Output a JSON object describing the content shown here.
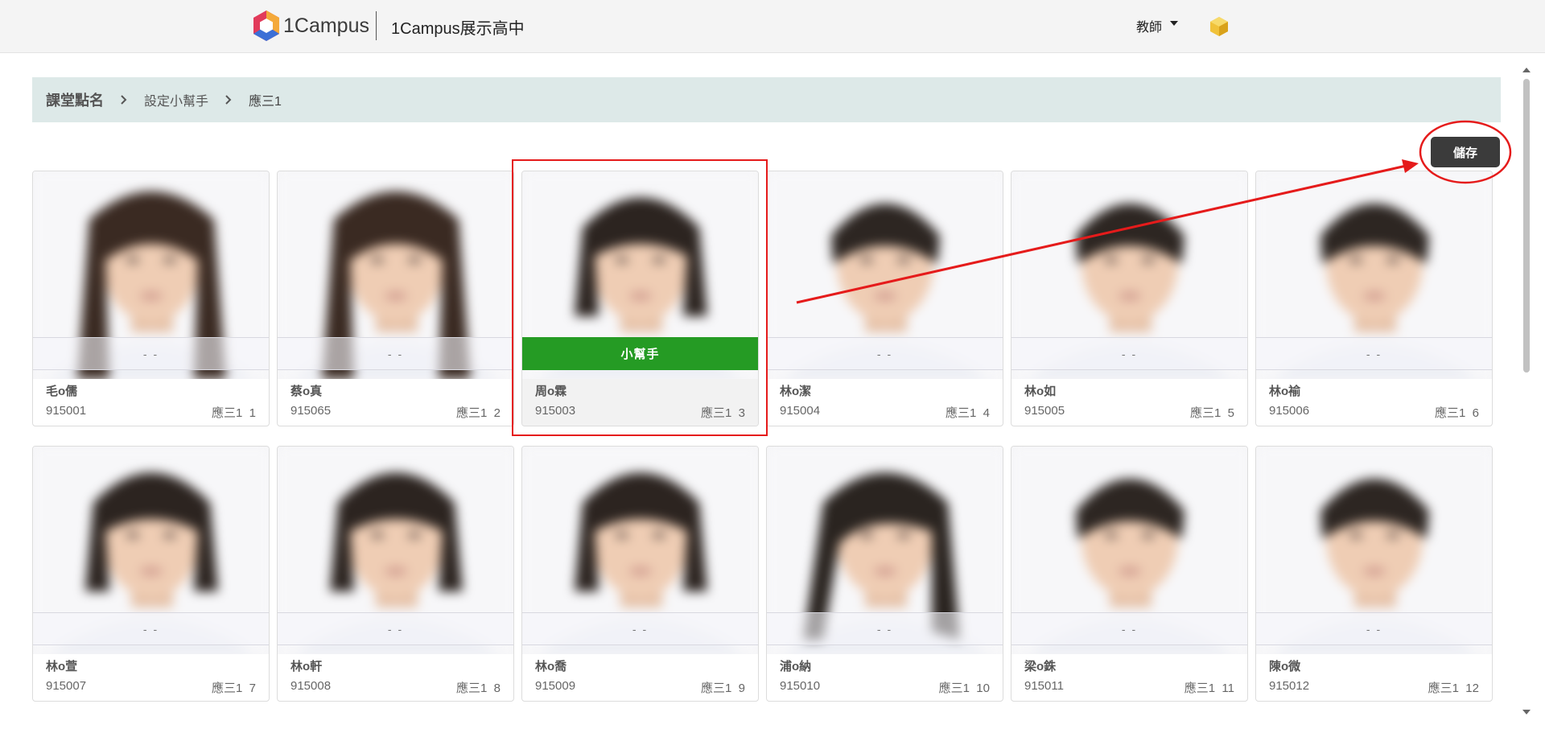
{
  "header": {
    "logo_text": "1Campus",
    "school_name": "1Campus展示高中",
    "role_label": "教師",
    "user_icon": "cube-icon"
  },
  "breadcrumb": {
    "items": [
      "課堂點名",
      "設定小幫手",
      "應三1"
    ]
  },
  "toolbar": {
    "save_label": "儲存"
  },
  "students": [
    {
      "name": "毛o儒",
      "id": "915001",
      "class_seat": "應三1  1",
      "status": "- -",
      "helper": false
    },
    {
      "name": "蔡o真",
      "id": "915065",
      "class_seat": "應三1  2",
      "status": "- -",
      "helper": false
    },
    {
      "name": "周o霖",
      "id": "915003",
      "class_seat": "應三1  3",
      "status": "小幫手",
      "helper": true
    },
    {
      "name": "林o潔",
      "id": "915004",
      "class_seat": "應三1  4",
      "status": "- -",
      "helper": false
    },
    {
      "name": "林o如",
      "id": "915005",
      "class_seat": "應三1  5",
      "status": "- -",
      "helper": false
    },
    {
      "name": "林o褕",
      "id": "915006",
      "class_seat": "應三1  6",
      "status": "- -",
      "helper": false
    },
    {
      "name": "林o萱",
      "id": "915007",
      "class_seat": "應三1  7",
      "status": "- -",
      "helper": false
    },
    {
      "name": "林o軒",
      "id": "915008",
      "class_seat": "應三1  8",
      "status": "- -",
      "helper": false
    },
    {
      "name": "林o喬",
      "id": "915009",
      "class_seat": "應三1  9",
      "status": "- -",
      "helper": false
    },
    {
      "name": "浦o納",
      "id": "915010",
      "class_seat": "應三1  10",
      "status": "- -",
      "helper": false
    },
    {
      "name": "梁o銖",
      "id": "915011",
      "class_seat": "應三1  11",
      "status": "- -",
      "helper": false
    },
    {
      "name": "陳o微",
      "id": "915012",
      "class_seat": "應三1  12",
      "status": "- -",
      "helper": false
    }
  ],
  "colors": {
    "helper_green": "#259b24",
    "annotation_red": "#e51b1b",
    "breadcrumb_bg": "#dde9e8",
    "save_bg": "#3b3b3b"
  }
}
